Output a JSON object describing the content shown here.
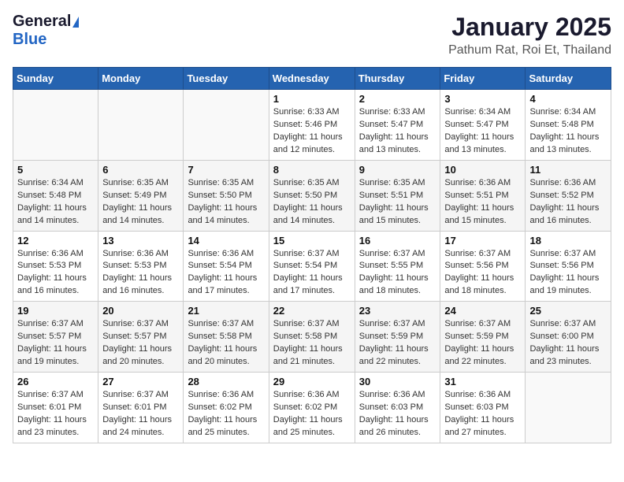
{
  "logo": {
    "general": "General",
    "blue": "Blue"
  },
  "title": "January 2025",
  "location": "Pathum Rat, Roi Et, Thailand",
  "weekdays": [
    "Sunday",
    "Monday",
    "Tuesday",
    "Wednesday",
    "Thursday",
    "Friday",
    "Saturday"
  ],
  "weeks": [
    [
      {
        "day": "",
        "info": ""
      },
      {
        "day": "",
        "info": ""
      },
      {
        "day": "",
        "info": ""
      },
      {
        "day": "1",
        "info": "Sunrise: 6:33 AM\nSunset: 5:46 PM\nDaylight: 11 hours\nand 12 minutes."
      },
      {
        "day": "2",
        "info": "Sunrise: 6:33 AM\nSunset: 5:47 PM\nDaylight: 11 hours\nand 13 minutes."
      },
      {
        "day": "3",
        "info": "Sunrise: 6:34 AM\nSunset: 5:47 PM\nDaylight: 11 hours\nand 13 minutes."
      },
      {
        "day": "4",
        "info": "Sunrise: 6:34 AM\nSunset: 5:48 PM\nDaylight: 11 hours\nand 13 minutes."
      }
    ],
    [
      {
        "day": "5",
        "info": "Sunrise: 6:34 AM\nSunset: 5:48 PM\nDaylight: 11 hours\nand 14 minutes."
      },
      {
        "day": "6",
        "info": "Sunrise: 6:35 AM\nSunset: 5:49 PM\nDaylight: 11 hours\nand 14 minutes."
      },
      {
        "day": "7",
        "info": "Sunrise: 6:35 AM\nSunset: 5:50 PM\nDaylight: 11 hours\nand 14 minutes."
      },
      {
        "day": "8",
        "info": "Sunrise: 6:35 AM\nSunset: 5:50 PM\nDaylight: 11 hours\nand 14 minutes."
      },
      {
        "day": "9",
        "info": "Sunrise: 6:35 AM\nSunset: 5:51 PM\nDaylight: 11 hours\nand 15 minutes."
      },
      {
        "day": "10",
        "info": "Sunrise: 6:36 AM\nSunset: 5:51 PM\nDaylight: 11 hours\nand 15 minutes."
      },
      {
        "day": "11",
        "info": "Sunrise: 6:36 AM\nSunset: 5:52 PM\nDaylight: 11 hours\nand 16 minutes."
      }
    ],
    [
      {
        "day": "12",
        "info": "Sunrise: 6:36 AM\nSunset: 5:53 PM\nDaylight: 11 hours\nand 16 minutes."
      },
      {
        "day": "13",
        "info": "Sunrise: 6:36 AM\nSunset: 5:53 PM\nDaylight: 11 hours\nand 16 minutes."
      },
      {
        "day": "14",
        "info": "Sunrise: 6:36 AM\nSunset: 5:54 PM\nDaylight: 11 hours\nand 17 minutes."
      },
      {
        "day": "15",
        "info": "Sunrise: 6:37 AM\nSunset: 5:54 PM\nDaylight: 11 hours\nand 17 minutes."
      },
      {
        "day": "16",
        "info": "Sunrise: 6:37 AM\nSunset: 5:55 PM\nDaylight: 11 hours\nand 18 minutes."
      },
      {
        "day": "17",
        "info": "Sunrise: 6:37 AM\nSunset: 5:56 PM\nDaylight: 11 hours\nand 18 minutes."
      },
      {
        "day": "18",
        "info": "Sunrise: 6:37 AM\nSunset: 5:56 PM\nDaylight: 11 hours\nand 19 minutes."
      }
    ],
    [
      {
        "day": "19",
        "info": "Sunrise: 6:37 AM\nSunset: 5:57 PM\nDaylight: 11 hours\nand 19 minutes."
      },
      {
        "day": "20",
        "info": "Sunrise: 6:37 AM\nSunset: 5:57 PM\nDaylight: 11 hours\nand 20 minutes."
      },
      {
        "day": "21",
        "info": "Sunrise: 6:37 AM\nSunset: 5:58 PM\nDaylight: 11 hours\nand 20 minutes."
      },
      {
        "day": "22",
        "info": "Sunrise: 6:37 AM\nSunset: 5:58 PM\nDaylight: 11 hours\nand 21 minutes."
      },
      {
        "day": "23",
        "info": "Sunrise: 6:37 AM\nSunset: 5:59 PM\nDaylight: 11 hours\nand 22 minutes."
      },
      {
        "day": "24",
        "info": "Sunrise: 6:37 AM\nSunset: 5:59 PM\nDaylight: 11 hours\nand 22 minutes."
      },
      {
        "day": "25",
        "info": "Sunrise: 6:37 AM\nSunset: 6:00 PM\nDaylight: 11 hours\nand 23 minutes."
      }
    ],
    [
      {
        "day": "26",
        "info": "Sunrise: 6:37 AM\nSunset: 6:01 PM\nDaylight: 11 hours\nand 23 minutes."
      },
      {
        "day": "27",
        "info": "Sunrise: 6:37 AM\nSunset: 6:01 PM\nDaylight: 11 hours\nand 24 minutes."
      },
      {
        "day": "28",
        "info": "Sunrise: 6:36 AM\nSunset: 6:02 PM\nDaylight: 11 hours\nand 25 minutes."
      },
      {
        "day": "29",
        "info": "Sunrise: 6:36 AM\nSunset: 6:02 PM\nDaylight: 11 hours\nand 25 minutes."
      },
      {
        "day": "30",
        "info": "Sunrise: 6:36 AM\nSunset: 6:03 PM\nDaylight: 11 hours\nand 26 minutes."
      },
      {
        "day": "31",
        "info": "Sunrise: 6:36 AM\nSunset: 6:03 PM\nDaylight: 11 hours\nand 27 minutes."
      },
      {
        "day": "",
        "info": ""
      }
    ]
  ]
}
